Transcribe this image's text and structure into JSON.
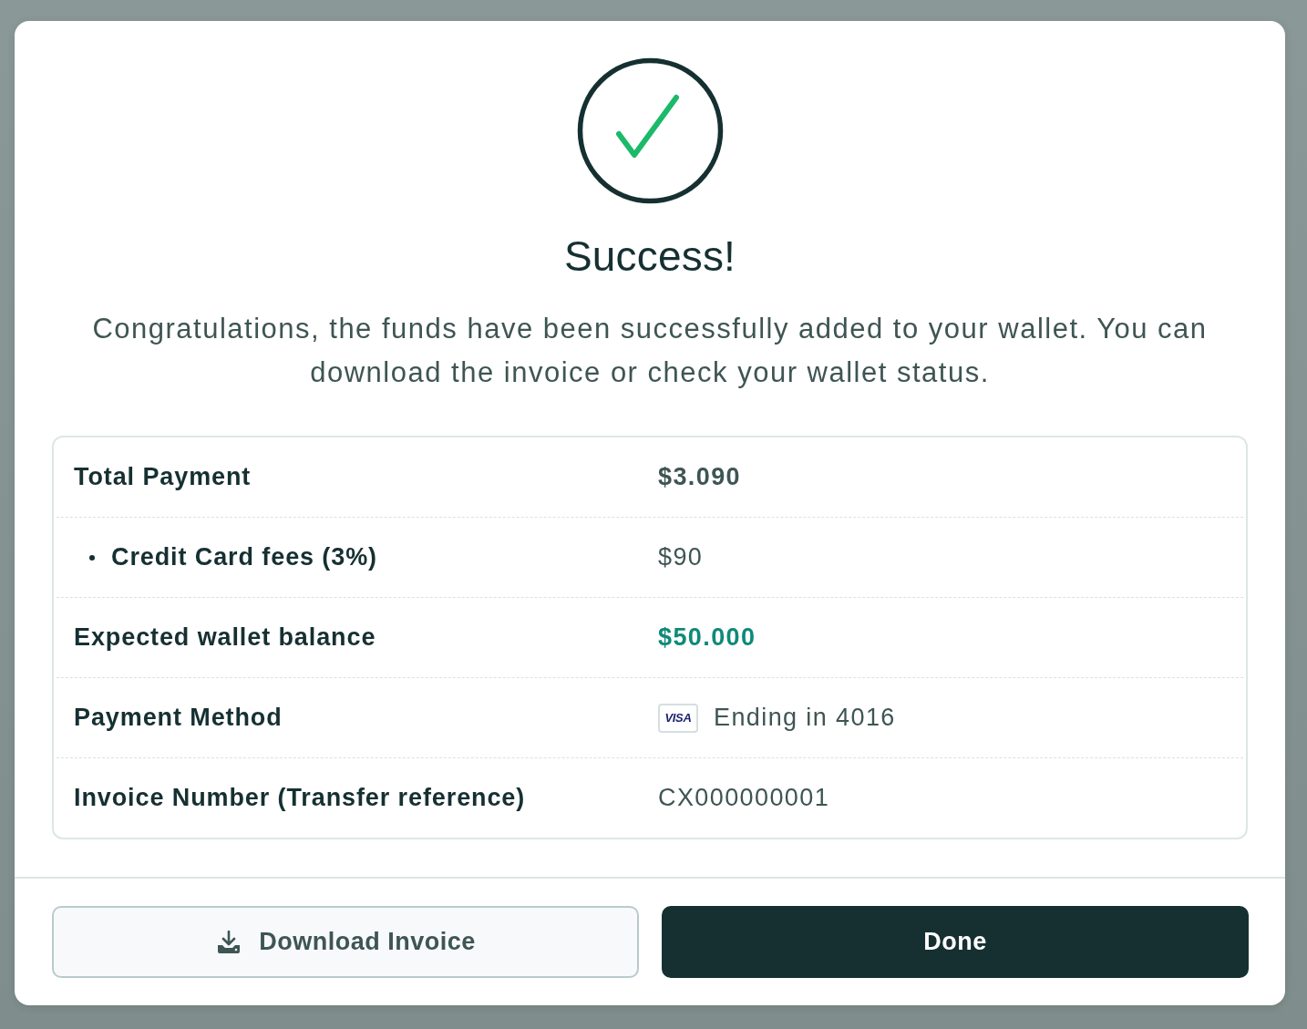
{
  "dialog": {
    "title": "Success!",
    "message": "Congratulations, the funds have been successfully added to your wallet. You can download the invoice or check your wallet status."
  },
  "summary": {
    "rows": [
      {
        "label": "Total Payment",
        "value": "$3.090",
        "kind": "total"
      },
      {
        "label": "Credit Card fees (3%)",
        "value": "$90",
        "kind": "fee"
      },
      {
        "label": "Expected wallet balance",
        "value": "$50.000",
        "kind": "balance"
      },
      {
        "label": "Payment Method",
        "value": "Ending in 4016",
        "kind": "card",
        "card_brand": "VISA"
      },
      {
        "label": "Invoice Number (Transfer reference)",
        "value": "CX000000001",
        "kind": "reference"
      }
    ]
  },
  "buttons": [
    {
      "label": "Download Invoice",
      "kind": "secondary"
    },
    {
      "label": "Done",
      "kind": "primary"
    }
  ]
}
